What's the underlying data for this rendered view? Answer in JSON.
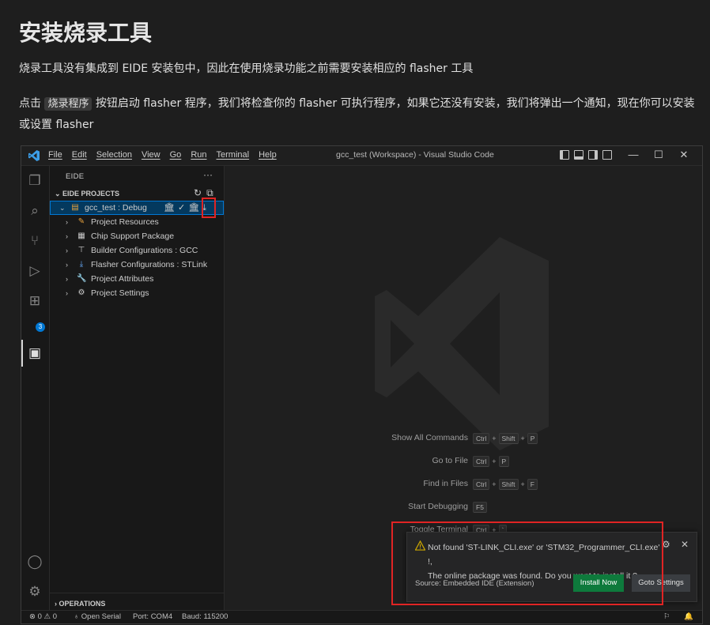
{
  "doc": {
    "title": "安装烧录工具",
    "para1": "烧录工具没有集成到 EIDE 安装包中，因此在使用烧录功能之前需要安装相应的 flasher 工具",
    "para2_pre": "点击 ",
    "para2_code": "烧录程序",
    "para2_post": " 按钮启动 flasher 程序，我们将检查你的 flasher 可执行程序，如果它还没有安装，我们将弹出一个通知，现在你可以安装或设置 flasher"
  },
  "vscode": {
    "menu": [
      "File",
      "Edit",
      "Selection",
      "View",
      "Go",
      "Run",
      "Terminal",
      "Help"
    ],
    "window_title": "gcc_test (Workspace) - Visual Studio Code",
    "window_controls": {
      "minimize": "—",
      "maximize": "☐",
      "close": "✕"
    },
    "activity_badge": "3",
    "sidebar": {
      "title": "EIDE",
      "more": "···",
      "section": "EIDE PROJECTS",
      "project": "gcc_test : Debug",
      "items": [
        "Project Resources",
        "Chip Support Package",
        "Builder Configurations : GCC",
        "Flasher Configurations : STLink",
        "Project Attributes",
        "Project Settings"
      ],
      "operations": "OPERATIONS"
    },
    "shortcuts": [
      {
        "label": "Show All Commands",
        "keys": [
          "Ctrl",
          "Shift",
          "P"
        ]
      },
      {
        "label": "Go to File",
        "keys": [
          "Ctrl",
          "P"
        ]
      },
      {
        "label": "Find in Files",
        "keys": [
          "Ctrl",
          "Shift",
          "F"
        ]
      },
      {
        "label": "Start Debugging",
        "keys": [
          "F5"
        ]
      },
      {
        "label": "Toggle Terminal",
        "keys": [
          "Ctrl",
          "`"
        ]
      }
    ],
    "notification": {
      "line1": "Not found 'ST-LINK_CLI.exe' or 'STM32_Programmer_CLI.exe' !,",
      "line2": "The online package was found. Do you want to install it ?",
      "source": "Source: Embedded IDE (Extension)",
      "install_label": "Install Now",
      "goto_label": "Goto Settings"
    },
    "status": {
      "errors": "0",
      "warnings": "0",
      "open_serial": "Open Serial",
      "port": "Port: COM4",
      "baud": "Baud: 115200"
    },
    "colors": {
      "accent": "#0078d4",
      "install_button": "#0e7a3c",
      "highlight_box": "#e02424",
      "warning": "#cca700"
    }
  }
}
